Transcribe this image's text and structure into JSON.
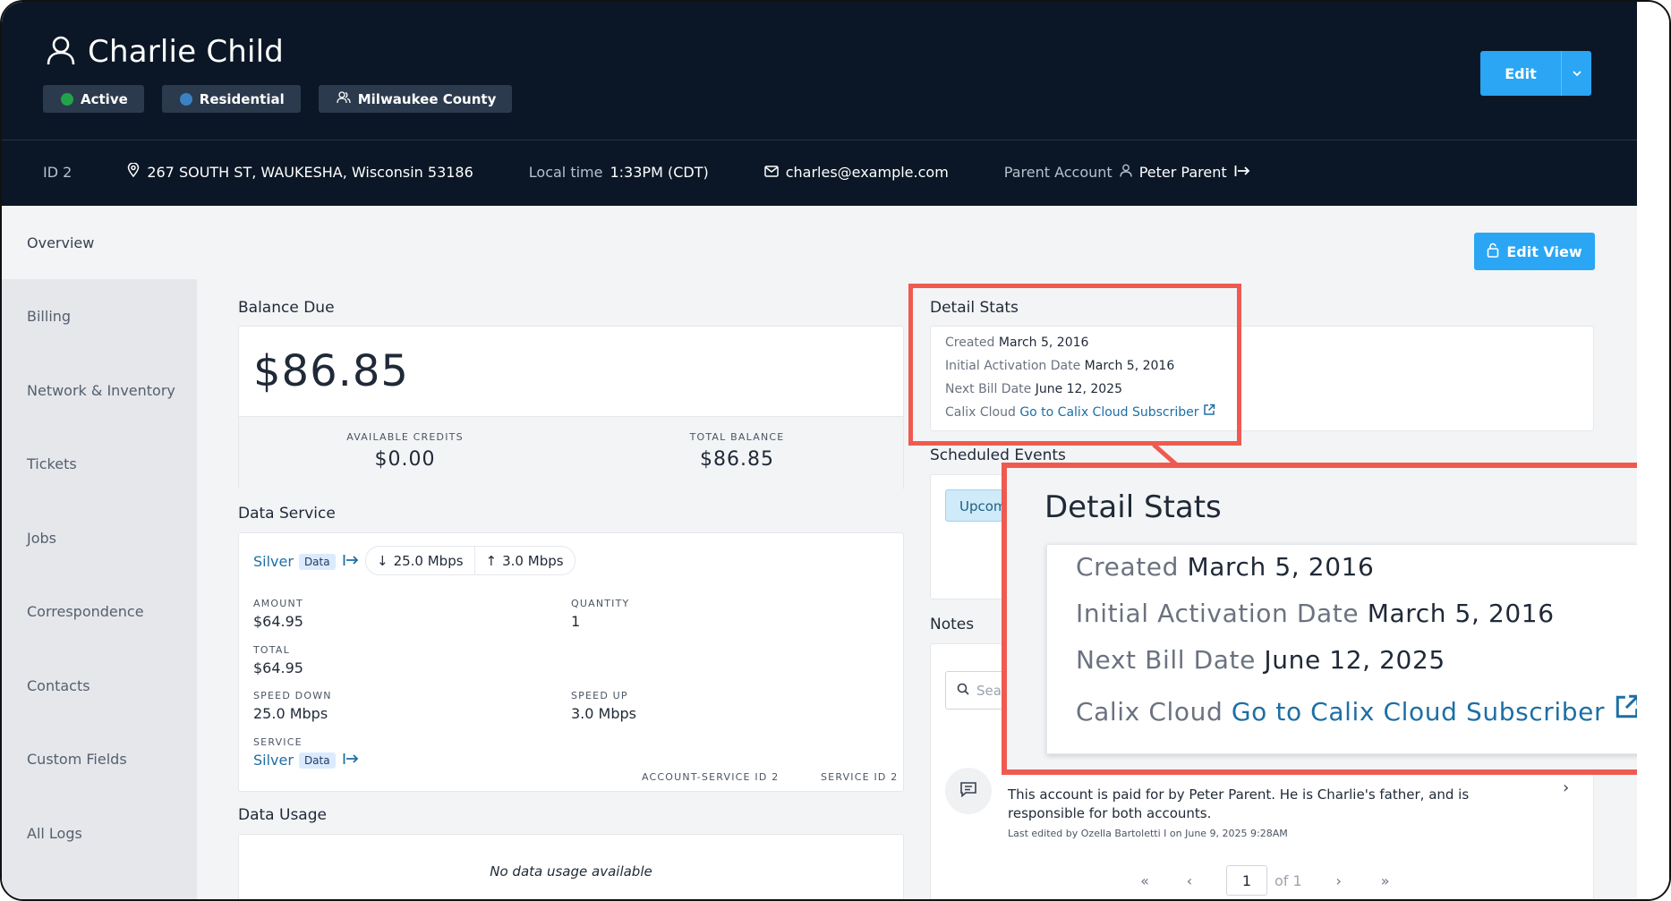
{
  "customer": {
    "name": "Charlie Child",
    "badges": [
      {
        "label": "Active",
        "color": "#22a34a"
      },
      {
        "label": "Residential",
        "color": "#3b82c4"
      },
      {
        "label": "Milwaukee County",
        "icon": "users-icon"
      }
    ],
    "edit_label": "Edit"
  },
  "infobar": {
    "id": "ID 2",
    "address": "267 SOUTH ST, WAUKESHA, Wisconsin 53186",
    "local_time_label": "Local time",
    "local_time": "1:33PM (CDT)",
    "email": "charles@example.com",
    "parent_label": "Parent Account",
    "parent_name": "Peter Parent"
  },
  "sidebar": {
    "items": [
      {
        "label": "Overview"
      },
      {
        "label": "Billing"
      },
      {
        "label": "Network & Inventory"
      },
      {
        "label": "Tickets"
      },
      {
        "label": "Jobs"
      },
      {
        "label": "Correspondence"
      },
      {
        "label": "Contacts"
      },
      {
        "label": "Custom Fields"
      },
      {
        "label": "All Logs"
      }
    ]
  },
  "edit_view_label": "Edit View",
  "balance": {
    "title": "Balance Due",
    "amount": "$86.85",
    "credits_label": "AVAILABLE CREDITS",
    "credits": "$0.00",
    "total_label": "TOTAL BALANCE",
    "total": "$86.85"
  },
  "data_service": {
    "title": "Data Service",
    "plan": "Silver",
    "plan_tag": "Data",
    "down": "25.0 Mbps",
    "up": "3.0 Mbps",
    "amount_label": "AMOUNT",
    "amount": "$64.95",
    "quantity_label": "QUANTITY",
    "quantity": "1",
    "total_label": "TOTAL",
    "total": "$64.95",
    "speed_down_label": "SPEED DOWN",
    "speed_down": "25.0 Mbps",
    "speed_up_label": "SPEED UP",
    "speed_up": "3.0 Mbps",
    "service_label": "SERVICE",
    "service": "Silver",
    "service_tag": "Data",
    "account_service_id": "ACCOUNT-SERVICE ID 2",
    "service_id": "SERVICE ID 2"
  },
  "data_usage": {
    "title": "Data Usage",
    "empty": "No data usage available"
  },
  "detail_stats": {
    "title": "Detail Stats",
    "created_label": "Created",
    "created": "March 5, 2016",
    "activation_label": "Initial Activation Date",
    "activation": "March 5, 2016",
    "next_bill_label": "Next Bill Date",
    "next_bill": "June 12, 2025",
    "calix_label": "Calix Cloud",
    "calix_link": "Go to Calix Cloud Subscriber"
  },
  "scheduled": {
    "title": "Scheduled Events",
    "tab": "Upcom"
  },
  "notes": {
    "title": "Notes",
    "search_placeholder": "Sea",
    "note_text": "This account is paid for by Peter Parent. He is Charlie's father, and is responsible for both accounts.",
    "note_meta": "Last edited by Ozella Bartoletti I on June 9, 2025 9:28AM",
    "pager": {
      "first": "«",
      "prev": "‹",
      "page": "1",
      "of": "of 1",
      "next": "›",
      "last": "»"
    }
  }
}
